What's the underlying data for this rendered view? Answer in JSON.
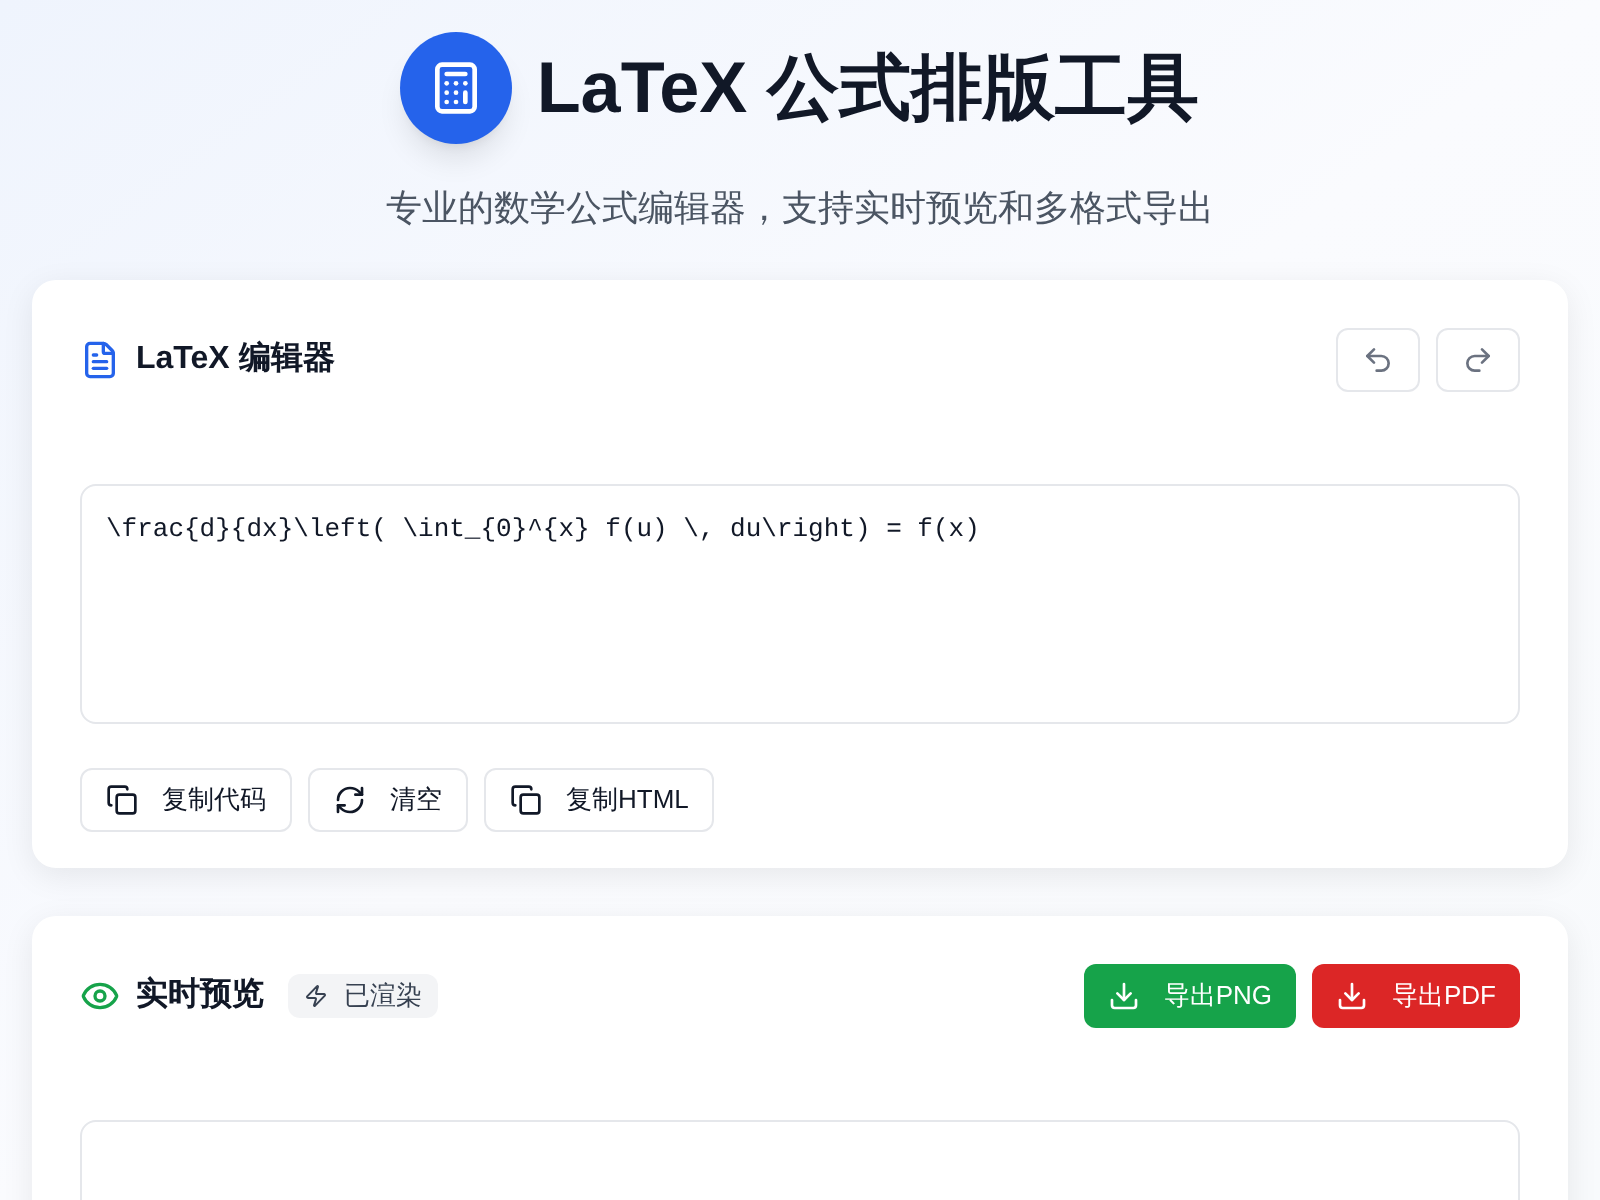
{
  "header": {
    "title": "LaTeX 公式排版工具",
    "subtitle": "专业的数学公式编辑器，支持实时预览和多格式导出"
  },
  "editor": {
    "title": "LaTeX 编辑器",
    "code": "\\frac{d}{dx}\\left( \\int_{0}^{x} f(u) \\, du\\right) = f(x)",
    "actions": [
      {
        "kind": "copy",
        "label": "复制代码"
      },
      {
        "kind": "refresh",
        "label": "清空"
      },
      {
        "kind": "copy",
        "label": "复制HTML"
      }
    ]
  },
  "preview": {
    "title": "实时预览",
    "badge": "已渲染",
    "exports": [
      {
        "label": "导出PNG",
        "color": "#16a34a"
      },
      {
        "label": "导出PDF",
        "color": "#dc2626"
      }
    ]
  }
}
